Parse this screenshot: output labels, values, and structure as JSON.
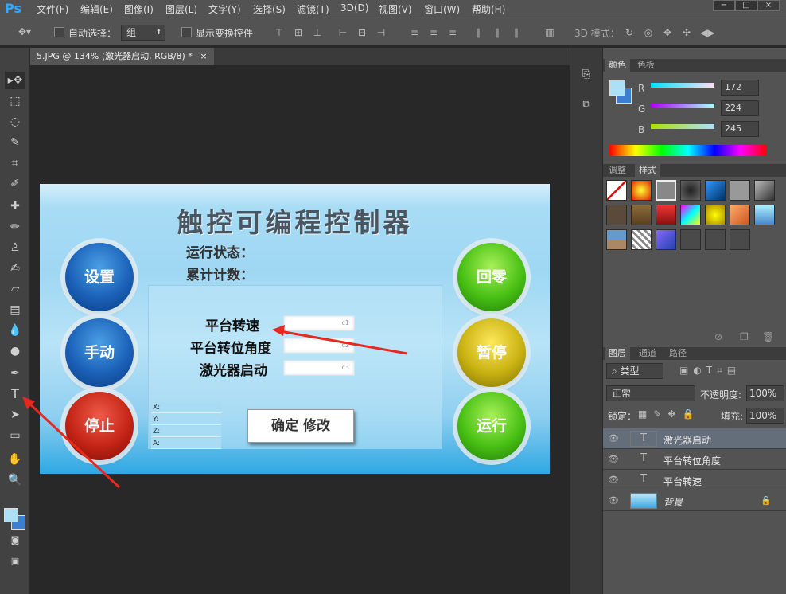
{
  "app": {
    "logo": "Ps"
  },
  "menu": [
    "文件(F)",
    "编辑(E)",
    "图像(I)",
    "图层(L)",
    "文字(Y)",
    "选择(S)",
    "滤镜(T)",
    "3D(D)",
    "视图(V)",
    "窗口(W)",
    "帮助(H)"
  ],
  "window_controls": {
    "minimize": "−",
    "maximize": "□",
    "close": "×"
  },
  "options_bar": {
    "auto_select_label": "自动选择：",
    "auto_select_value": "组",
    "show_transform_label": "显示变换控件",
    "mode3d_label": "3D 模式："
  },
  "document": {
    "tab_title": "5.JPG @ 134% (激光器启动, RGB/8) *",
    "close": "×"
  },
  "design": {
    "title": "触控可编程控制器",
    "status_label": "运行状态：",
    "count_label": "累计计数：",
    "buttons_left": [
      "设置",
      "手动",
      "停止"
    ],
    "buttons_right": [
      "回零",
      "暂停",
      "运行"
    ],
    "field_labels": [
      "平台转速",
      "平台转位角度",
      "激光器启动"
    ],
    "field_hints": [
      "c1",
      "c2",
      "c3"
    ],
    "coords": [
      "X:",
      "Y:",
      "Z:",
      "A:"
    ],
    "confirm_button": "确定 修改"
  },
  "color_panel": {
    "tabs": [
      "颜色",
      "色板"
    ],
    "channels": [
      {
        "label": "R",
        "value": "172"
      },
      {
        "label": "G",
        "value": "224"
      },
      {
        "label": "B",
        "value": "245"
      }
    ],
    "foreground": "#ace0f5",
    "background": "#3a7fd0"
  },
  "styles_panel": {
    "tabs": [
      "调整",
      "样式"
    ]
  },
  "layers_panel": {
    "tabs": [
      "图层",
      "通道",
      "路径"
    ],
    "filter_label": "类型",
    "blend_mode": "正常",
    "opacity_label": "不透明度:",
    "opacity_value": "100%",
    "lock_label": "锁定：",
    "fill_label": "填充:",
    "fill_value": "100%",
    "layers": [
      {
        "name": "激光器启动",
        "type": "T",
        "selected": true
      },
      {
        "name": "平台转位角度",
        "type": "T",
        "selected": false
      },
      {
        "name": "平台转速",
        "type": "T",
        "selected": false
      },
      {
        "name": "背景",
        "type": "image",
        "selected": false
      }
    ]
  }
}
